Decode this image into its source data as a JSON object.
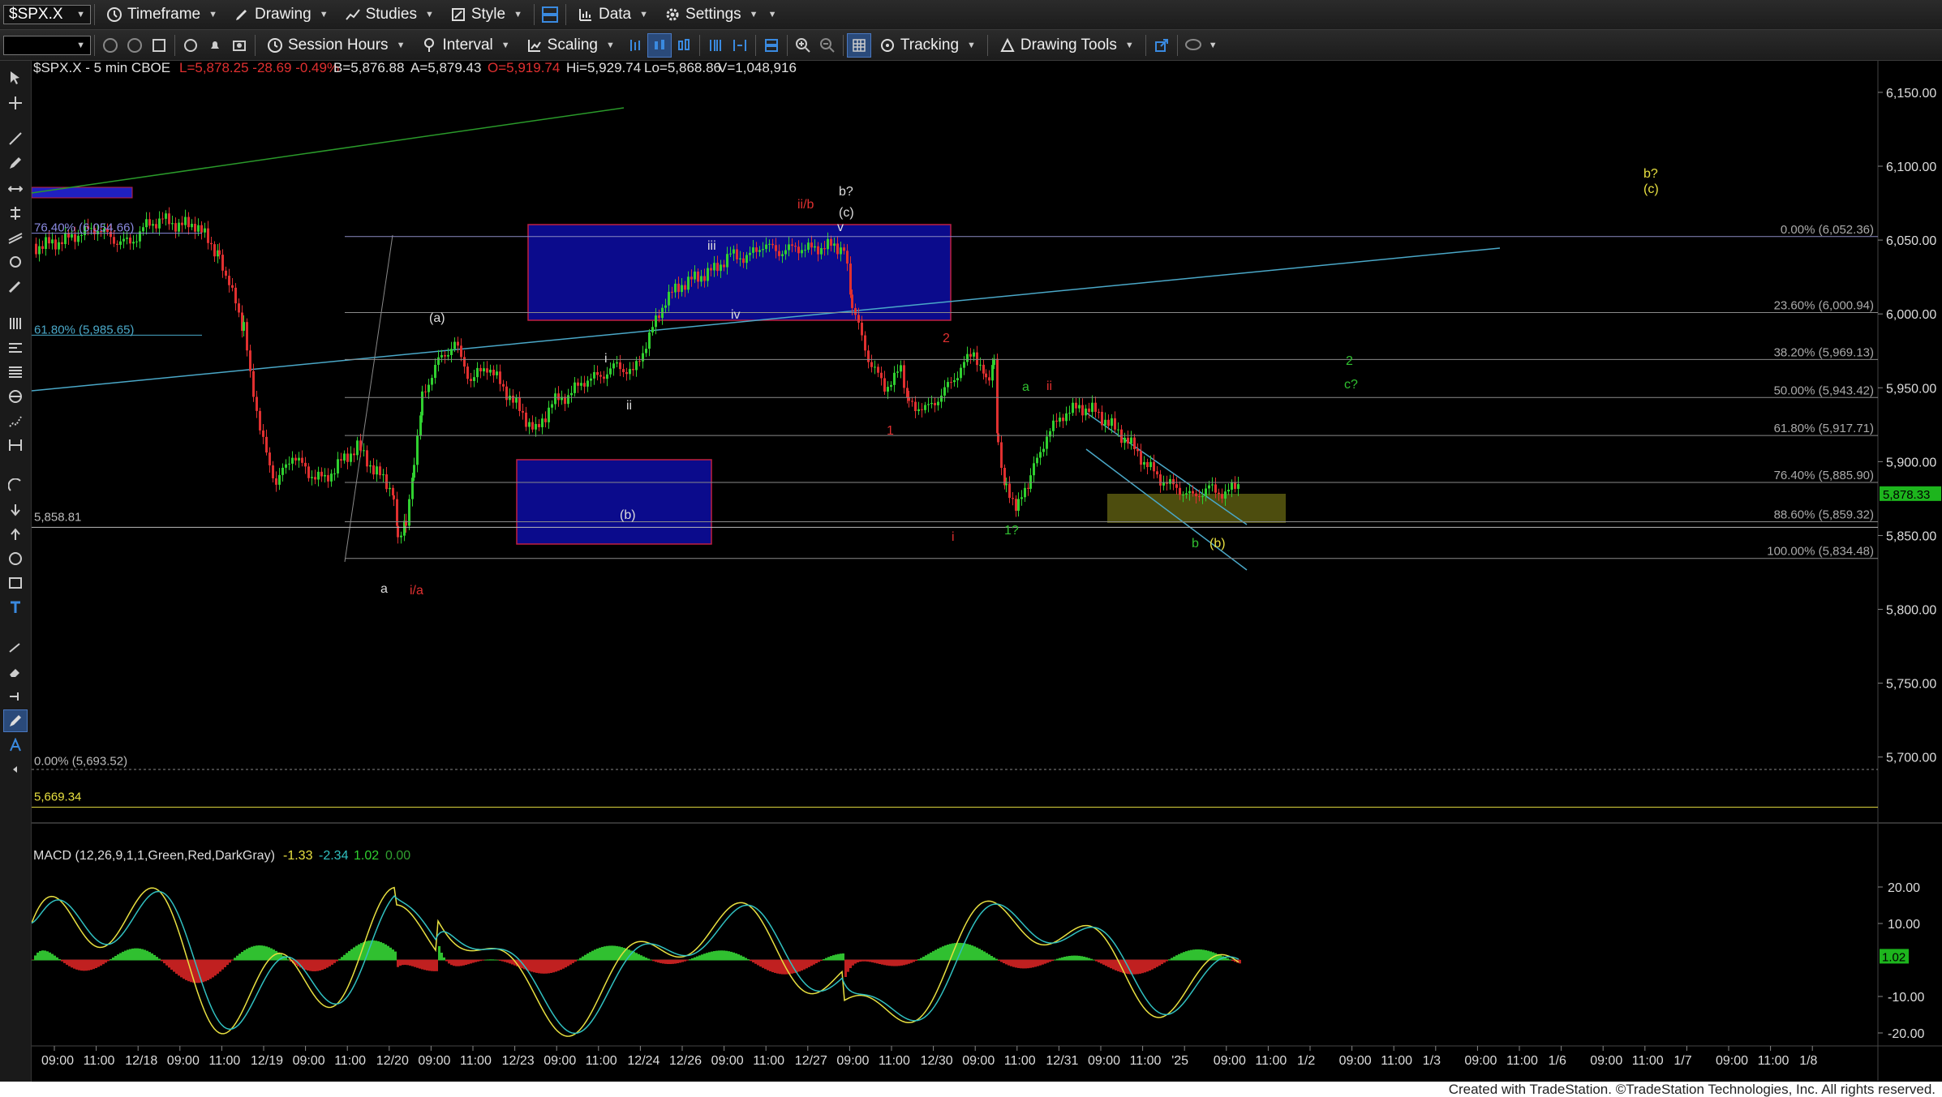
{
  "toolbar1": {
    "symbol": "$SPX.X",
    "timeframe": "Timeframe",
    "drawing": "Drawing",
    "studies": "Studies",
    "style": "Style",
    "data": "Data",
    "settings": "Settings"
  },
  "toolbar2": {
    "session_hours": "Session Hours",
    "interval": "Interval",
    "scaling": "Scaling",
    "tracking": "Tracking",
    "drawing_tools": "Drawing Tools"
  },
  "header": {
    "symbol": "$SPX.X - 5 min CBOE",
    "last": "L=5,878.25 -28.69 -0.49%",
    "bid": "B=5,876.88",
    "ask": "A=5,879.43",
    "open": "O=5,919.74",
    "high": "Hi=5,929.74",
    "low": "Lo=5,868.86",
    "volume": "V=1,048,916"
  },
  "price_axis": {
    "ticks": [
      "6,150.00",
      "6,100.00",
      "6,050.00",
      "6,000.00",
      "5,950.00",
      "5,900.00",
      "5,850.00",
      "5,800.00",
      "5,750.00",
      "5,700.00"
    ],
    "last_label": "5,878.33"
  },
  "fib_levels": [
    {
      "label": "0.00% (6,052.36)",
      "price": 6052.36
    },
    {
      "label": "23.60% (6,000.94)",
      "price": 6000.94
    },
    {
      "label": "38.20% (5,969.13)",
      "price": 5969.13
    },
    {
      "label": "50.00% (5,943.42)",
      "price": 5943.42
    },
    {
      "label": "61.80% (5,917.71)",
      "price": 5917.71
    },
    {
      "label": "76.40% (5,885.90)",
      "price": 5885.9
    },
    {
      "label": "88.60% (5,859.32)",
      "price": 5859.32
    },
    {
      "label": "100.00% (5,834.48)",
      "price": 5834.48
    }
  ],
  "left_levels": [
    {
      "label": "76.40% (6,054.66)",
      "price": 6054.66
    },
    {
      "label": "61.80% (5,985.65)",
      "price": 5985.65
    },
    {
      "label": "5,858.81",
      "price": 5858.81
    },
    {
      "label": "0.00% (5,693.52)",
      "price": 5693.52
    },
    {
      "label": "5,669.34",
      "price": 5669.34
    }
  ],
  "wave_labels": [
    {
      "text": "ii/b",
      "color": "#e03030"
    },
    {
      "text": "b?",
      "color": "#dddddd"
    },
    {
      "text": "(c)",
      "color": "#dddddd"
    },
    {
      "text": "v",
      "color": "#dddddd"
    },
    {
      "text": "iii",
      "color": "#dddddd"
    },
    {
      "text": "iv",
      "color": "#dddddd"
    },
    {
      "text": "(a)",
      "color": "#dddddd"
    },
    {
      "text": "i",
      "color": "#dddddd"
    },
    {
      "text": "ii",
      "color": "#dddddd"
    },
    {
      "text": "(b)",
      "color": "#dddddd"
    },
    {
      "text": "a",
      "color": "#dddddd"
    },
    {
      "text": "i/a",
      "color": "#e03030"
    },
    {
      "text": "2",
      "color": "#e03030"
    },
    {
      "text": "1",
      "color": "#e03030"
    },
    {
      "text": "i",
      "color": "#e03030"
    },
    {
      "text": "ii",
      "color": "#e03030"
    },
    {
      "text": "a",
      "color": "#30c030"
    },
    {
      "text": "1?",
      "color": "#30c030"
    },
    {
      "text": "b",
      "color": "#30c030"
    },
    {
      "text": "(b)",
      "color": "#e8e040"
    },
    {
      "text": "2",
      "color": "#30c030"
    },
    {
      "text": "c?",
      "color": "#30c030"
    },
    {
      "text": "b?",
      "color": "#e8e040"
    },
    {
      "text": "(c)",
      "color": "#e8e040"
    }
  ],
  "time_axis": [
    "09:00",
    "11:00",
    "12/18",
    "09:00",
    "11:00",
    "12/19",
    "09:00",
    "11:00",
    "12/20",
    "09:00",
    "11:00",
    "12/23",
    "09:00",
    "11:00",
    "12/24",
    "12/26",
    "09:00",
    "11:00",
    "12/27",
    "09:00",
    "11:00",
    "12/30",
    "09:00",
    "11:00",
    "12/31",
    "09:00",
    "11:00",
    "'25",
    "09:00",
    "11:00",
    "1/2",
    "09:00",
    "11:00",
    "1/3",
    "09:00",
    "11:00",
    "1/6",
    "09:00",
    "11:00",
    "1/7",
    "09:00",
    "11:00",
    "1/8"
  ],
  "macd": {
    "label": "MACD (12,26,9,1,1,Green,Red,DarkGray)",
    "v1": "-1.33",
    "v2": "-2.34",
    "v3": "1.02",
    "v4": "0.00",
    "ticks": [
      "20.00",
      "10.00",
      "-10.00",
      "-20.00"
    ],
    "last_label": "1.02"
  },
  "colors": {
    "up": "#30d030",
    "down": "#e03030",
    "blue_box": "#0b0b8c",
    "fib": "#8a8a8a",
    "green_macd": "#30c030",
    "red_macd": "#c02020"
  },
  "footer": "Created with TradeStation. ©TradeStation Technologies, Inc. All rights reserved."
}
